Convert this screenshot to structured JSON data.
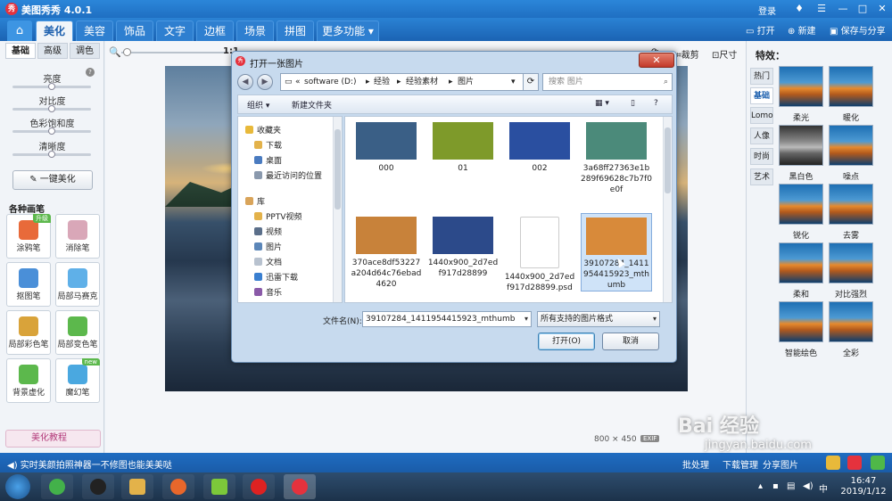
{
  "app": {
    "title": "美图秀秀 4.0.1",
    "logo": "秀",
    "login": "登录",
    "tabs": [
      {
        "label": "美化",
        "active": true
      },
      {
        "label": "美容"
      },
      {
        "label": "饰品"
      },
      {
        "label": "文字"
      },
      {
        "label": "边框"
      },
      {
        "label": "场景"
      },
      {
        "label": "拼图"
      },
      {
        "label": "更多功能 ▾"
      }
    ],
    "toolbar": {
      "open": "打开",
      "new": "新建",
      "save": "保存与分享"
    }
  },
  "left_panel": {
    "subtabs": [
      "基础",
      "高级",
      "调色"
    ],
    "sliders": [
      "亮度",
      "对比度",
      "色彩饱和度",
      "清晰度"
    ],
    "one_click": "一键美化",
    "brushes_title": "各种画笔",
    "tools": [
      {
        "label": "涂鸦笔",
        "badge": "升级"
      },
      {
        "label": "消除笔"
      },
      {
        "label": "抠图笔"
      },
      {
        "label": "局部马赛克"
      },
      {
        "label": "局部彩色笔"
      },
      {
        "label": "局部变色笔"
      },
      {
        "label": "背景虚化"
      },
      {
        "label": "魔幻笔",
        "badge": "new"
      }
    ],
    "tutorial": "美化教程"
  },
  "canvas": {
    "zoom_ratio": "1:1",
    "right_tools": [
      "旋转",
      "裁剪",
      "尺寸"
    ],
    "image_size": "800 × 450",
    "exif": "EXIF"
  },
  "right_panel": {
    "title": "特效：",
    "categories": [
      "热门",
      "基础",
      "Lomo",
      "人像",
      "时尚",
      "艺术"
    ],
    "active_category": "基础",
    "effects": [
      "柔光",
      "暖化",
      "黑白色",
      "噪点",
      "锐化",
      "去雾",
      "柔和",
      "对比强烈",
      "智能绘色",
      "全彩"
    ]
  },
  "status_bar": {
    "text": "实时美颜拍照神器一不修图也能美美哒",
    "items": [
      "批处理",
      "下载管理",
      "分享图片"
    ]
  },
  "taskbar": {
    "time": "16:47",
    "date": "2019/1/12"
  },
  "dialog": {
    "title": "打开一张图片",
    "close": "✕",
    "address": {
      "prefix": "«",
      "segments": [
        "software (D:)",
        "经验",
        "经验素材",
        "图片"
      ]
    },
    "search_placeholder": "搜索 图片",
    "commands": {
      "organize": "组织 ▾",
      "new_folder": "新建文件夹"
    },
    "nav": [
      {
        "label": "收藏夹",
        "level": 0,
        "icon": "star"
      },
      {
        "label": "下载",
        "level": 1,
        "icon": "folder"
      },
      {
        "label": "桌面",
        "level": 1,
        "icon": "desktop"
      },
      {
        "label": "最近访问的位置",
        "level": 1,
        "icon": "recent"
      },
      {
        "label": "库",
        "level": 0,
        "icon": "library"
      },
      {
        "label": "PPTV视频",
        "level": 1,
        "icon": "folder"
      },
      {
        "label": "视频",
        "level": 1,
        "icon": "video"
      },
      {
        "label": "图片",
        "level": 1,
        "icon": "pictures"
      },
      {
        "label": "文档",
        "level": 1,
        "icon": "documents"
      },
      {
        "label": "迅雷下载",
        "level": 1,
        "icon": "folder"
      },
      {
        "label": "音乐",
        "level": 1,
        "icon": "music"
      }
    ],
    "files": [
      {
        "name": "000",
        "thumb": "#3a5f86"
      },
      {
        "name": "01",
        "thumb": "#7e9a2a"
      },
      {
        "name": "002",
        "thumb": "#2a4fa0"
      },
      {
        "name": "3a68ff27363e1b289f69628c7b7f0e0f",
        "thumb": "#4b8a7a"
      },
      {
        "name": "370ace8df53227a204d64c76ebad4620",
        "thumb": "#c8823a"
      },
      {
        "name": "1440x900_2d7edf917d28899",
        "thumb": "#2c4a8a"
      },
      {
        "name": "1440x900_2d7edf917d28899.psd",
        "thumb": "#ffffff"
      },
      {
        "name": "39107284_1411954415923_mthumb",
        "thumb": "#d88a3a",
        "selected": true
      }
    ],
    "filename_label": "文件名(N):",
    "filename_value": "39107284_1411954415923_mthumb",
    "filter": "所有支持的图片格式",
    "open_btn": "打开(O)",
    "cancel_btn": "取消"
  },
  "watermark": {
    "text": "Bai 经验",
    "url": "jingyan.baidu.com"
  },
  "colors": {
    "accent": "#1f6fc2",
    "dialog_bg": "#c7daee",
    "selected": "#cfe3f8"
  }
}
